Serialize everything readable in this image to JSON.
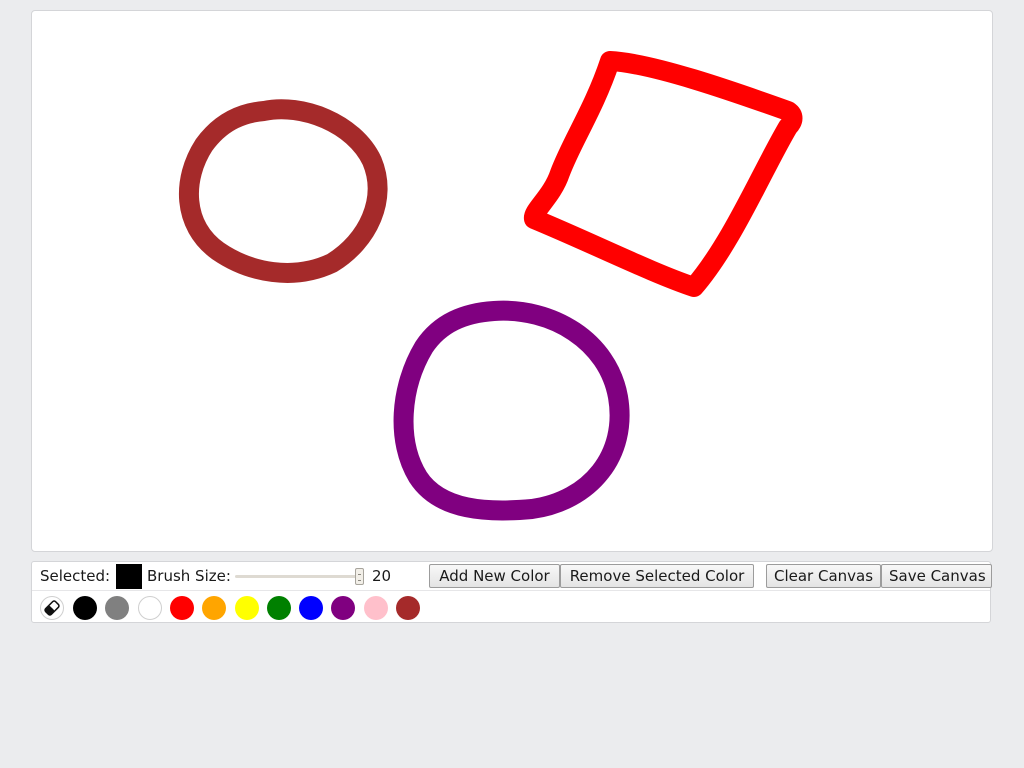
{
  "canvas": {
    "strokes": [
      {
        "name": "brown-circle-stroke",
        "color": "#a52a2a"
      },
      {
        "name": "red-quad-stroke",
        "color": "#ff0000"
      },
      {
        "name": "purple-circle-stroke",
        "color": "#800080"
      }
    ]
  },
  "toolbar": {
    "selected_label": "Selected:",
    "selected_color": "#000000",
    "brush_label": "Brush Size:",
    "brush_value": "20",
    "add_color_label": "Add New Color",
    "remove_color_label": "Remove Selected Color",
    "clear_label": "Clear Canvas",
    "save_label": "Save Canvas"
  },
  "palette": {
    "eraser_icon": "eraser-icon",
    "colors": [
      {
        "name": "black",
        "hex": "#000000"
      },
      {
        "name": "gray",
        "hex": "#808080"
      },
      {
        "name": "white",
        "hex": "#ffffff"
      },
      {
        "name": "red",
        "hex": "#ff0000"
      },
      {
        "name": "orange",
        "hex": "#ffa500"
      },
      {
        "name": "yellow",
        "hex": "#ffff00"
      },
      {
        "name": "green",
        "hex": "#008000"
      },
      {
        "name": "blue",
        "hex": "#0000ff"
      },
      {
        "name": "purple",
        "hex": "#800080"
      },
      {
        "name": "pink",
        "hex": "#ffc0cb"
      },
      {
        "name": "brown",
        "hex": "#a52a2a"
      }
    ]
  }
}
